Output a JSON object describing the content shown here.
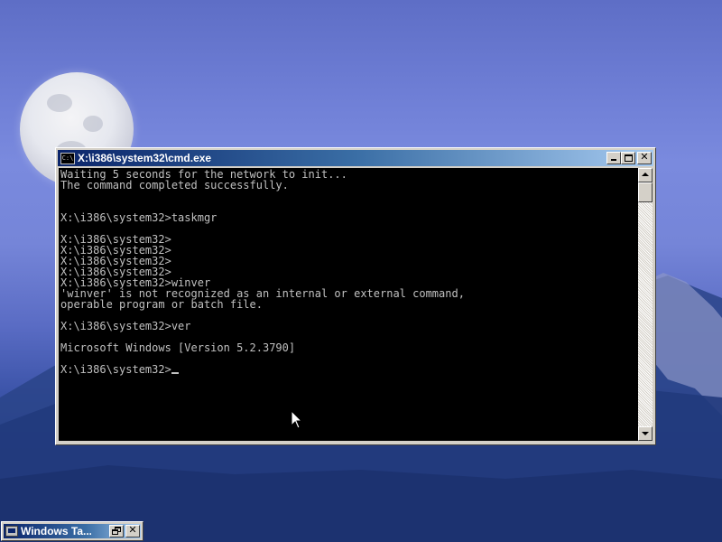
{
  "desktop": {
    "wallpaper": "moon-and-mountain",
    "accent_color": "#0a246a"
  },
  "console_window": {
    "title": "X:\\i386\\system32\\cmd.exe",
    "icon": "console-icon",
    "icon_text": "C:\\",
    "buttons": {
      "minimize": "minimize-icon",
      "maximize": "maximize-icon",
      "close": "close-icon",
      "close_glyph": "✕"
    },
    "output_lines": [
      "Waiting 5 seconds for the network to init...",
      "The command completed successfully.",
      "",
      "",
      "X:\\i386\\system32>taskmgr",
      "",
      "X:\\i386\\system32>",
      "X:\\i386\\system32>",
      "X:\\i386\\system32>",
      "X:\\i386\\system32>",
      "X:\\i386\\system32>winver",
      "'winver' is not recognized as an internal or external command,",
      "operable program or batch file.",
      "",
      "X:\\i386\\system32>ver",
      "",
      "Microsoft Windows [Version 5.2.3790]",
      "",
      "X:\\i386\\system32>"
    ],
    "text_color": "#c0c0c0",
    "background_color": "#000000"
  },
  "scrollbar": {
    "up_icon": "scroll-up-arrow-icon",
    "down_icon": "scroll-down-arrow-icon"
  },
  "minimized_window": {
    "title": "Windows Ta...",
    "icon": "task-manager-icon",
    "buttons": {
      "restore": "restore-icon",
      "close": "close-icon",
      "close_glyph": "✕"
    }
  }
}
